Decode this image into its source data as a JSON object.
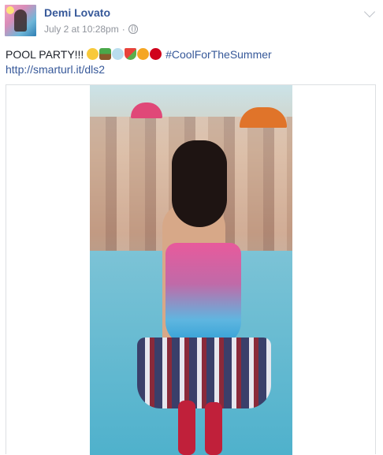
{
  "post": {
    "author": "Demi Lovato",
    "timestamp": "July 2 at 10:28pm",
    "separator": "·",
    "text_main": "POOL PARTY!!! ",
    "hashtag": "#CoolForTheSummer",
    "link": "http://smarturl.it/dls2"
  },
  "icons": {
    "audience": "globe-icon",
    "menu": "chevron-down-icon",
    "emojis": [
      "sunglasses-emoji",
      "palm-tree-emoji",
      "dash-emoji",
      "watermelon-emoji",
      "sun-emoji",
      "cherries-emoji"
    ]
  },
  "colors": {
    "link": "#365899",
    "meta": "#90949c",
    "text": "#1d2129",
    "border": "#dddfe2"
  }
}
